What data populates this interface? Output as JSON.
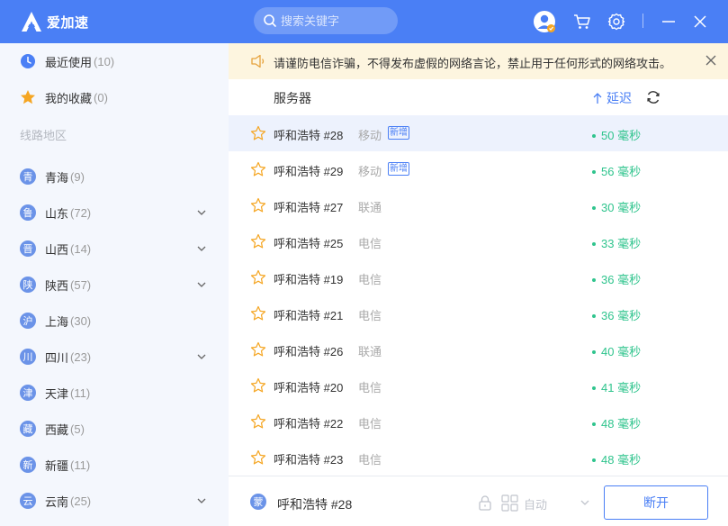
{
  "header": {
    "app_name": "爱加速",
    "search_placeholder": "搜索关键字"
  },
  "sidebar": {
    "recent": {
      "label": "最近使用",
      "count": "(10)"
    },
    "favorites": {
      "label": "我的收藏",
      "count": "(0)"
    },
    "section_title": "线路地区",
    "regions": [
      {
        "badge": "青",
        "label": "青海",
        "count": "(9)",
        "expandable": false
      },
      {
        "badge": "鲁",
        "label": "山东",
        "count": "(72)",
        "expandable": true
      },
      {
        "badge": "晋",
        "label": "山西",
        "count": "(14)",
        "expandable": true
      },
      {
        "badge": "陕",
        "label": "陕西",
        "count": "(57)",
        "expandable": true
      },
      {
        "badge": "沪",
        "label": "上海",
        "count": "(30)",
        "expandable": false
      },
      {
        "badge": "川",
        "label": "四川",
        "count": "(23)",
        "expandable": true
      },
      {
        "badge": "津",
        "label": "天津",
        "count": "(11)",
        "expandable": false
      },
      {
        "badge": "藏",
        "label": "西藏",
        "count": "(5)",
        "expandable": false
      },
      {
        "badge": "新",
        "label": "新疆",
        "count": "(11)",
        "expandable": false
      },
      {
        "badge": "云",
        "label": "云南",
        "count": "(25)",
        "expandable": true
      }
    ]
  },
  "notice": {
    "text": "请谨防电信诈骗，不得发布虚假的网络言论，禁止用于任何形式的网络攻击。"
  },
  "table": {
    "col_server": "服务器",
    "col_latency": "延迟"
  },
  "servers": [
    {
      "name": "呼和浩特 #28",
      "isp": "移动",
      "new": "新增",
      "latency": "50 毫秒",
      "selected": true
    },
    {
      "name": "呼和浩特 #29",
      "isp": "移动",
      "new": "新增",
      "latency": "56 毫秒",
      "selected": false
    },
    {
      "name": "呼和浩特 #27",
      "isp": "联通",
      "new": "",
      "latency": "30 毫秒",
      "selected": false
    },
    {
      "name": "呼和浩特 #25",
      "isp": "电信",
      "new": "",
      "latency": "33 毫秒",
      "selected": false
    },
    {
      "name": "呼和浩特 #19",
      "isp": "电信",
      "new": "",
      "latency": "36 毫秒",
      "selected": false
    },
    {
      "name": "呼和浩特 #21",
      "isp": "电信",
      "new": "",
      "latency": "36 毫秒",
      "selected": false
    },
    {
      "name": "呼和浩特 #26",
      "isp": "联通",
      "new": "",
      "latency": "40 毫秒",
      "selected": false
    },
    {
      "name": "呼和浩特 #20",
      "isp": "电信",
      "new": "",
      "latency": "41 毫秒",
      "selected": false
    },
    {
      "name": "呼和浩特 #22",
      "isp": "电信",
      "new": "",
      "latency": "48 毫秒",
      "selected": false
    },
    {
      "name": "呼和浩特 #23",
      "isp": "电信",
      "new": "",
      "latency": "48 毫秒",
      "selected": false
    }
  ],
  "footer": {
    "badge": "蒙",
    "current_server": "呼和浩特 #28",
    "mode": "自动",
    "disconnect_label": "断开"
  },
  "colors": {
    "accent": "#4a7ff5",
    "latency_good": "#2fc48d",
    "notice_bg": "#fdf5df"
  }
}
